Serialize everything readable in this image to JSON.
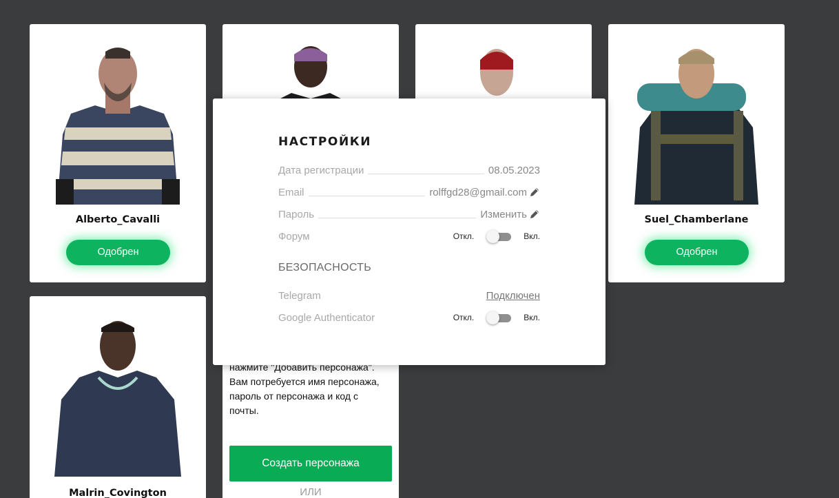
{
  "characters": [
    {
      "name": "Alberto_Cavalli",
      "status": "Одобрен"
    },
    {
      "name": "Suel_Chamberlane",
      "status": "Одобрен"
    },
    {
      "name": "Malrin_Covington"
    }
  ],
  "create_panel": {
    "instructions": "нажмите \"Добавить персонажа\".\nВам потребуется имя персонажа,\nпароль от персонажа и код с\nпочты.",
    "create_button": "Создать персонажа",
    "or_text": "ИЛИ"
  },
  "settings": {
    "title": "НАСТРОЙКИ",
    "reg_date_label": "Дата регистрации",
    "reg_date_value": "08.05.2023",
    "email_label": "Email",
    "email_value": "rolffgd28@gmail.com",
    "password_label": "Пароль",
    "password_value": "Изменить",
    "forum_label": "Форум",
    "toggle_off": "Откл.",
    "toggle_on": "Вкл.",
    "security_title": "БЕЗОПАСНОСТЬ",
    "telegram_label": "Telegram",
    "telegram_value": "Подключен",
    "ga_label": "Google Authenticator"
  },
  "toggles": {
    "forum_enabled": false,
    "ga_enabled": false
  },
  "colors": {
    "background": "#3b3c3e",
    "approved_green": "#0db35e",
    "create_green": "#0aab55"
  }
}
